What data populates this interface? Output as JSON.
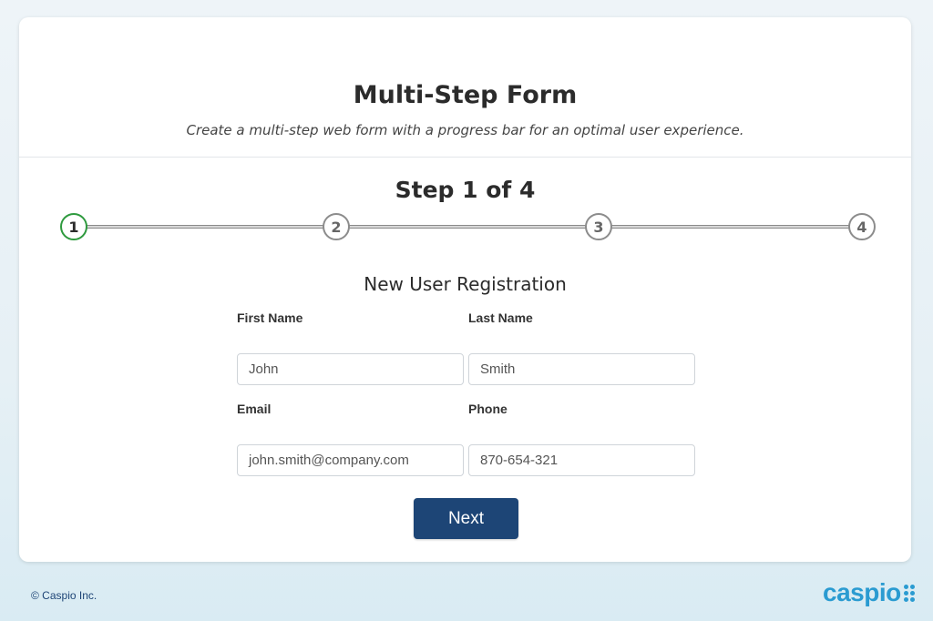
{
  "header": {
    "title": "Multi-Step Form",
    "subtitle": "Create a multi-step web form with a progress bar for an optimal user experience."
  },
  "progress": {
    "step_text": "Step 1 of 4",
    "current_step": 1,
    "total_steps": 4,
    "steps": [
      "1",
      "2",
      "3",
      "4"
    ],
    "active_color": "#2e9a3e",
    "inactive_color": "#8c8c8c"
  },
  "form": {
    "section_title": "New User Registration",
    "fields": {
      "first_name": {
        "label": "First Name",
        "value": "John"
      },
      "last_name": {
        "label": "Last Name",
        "value": "Smith"
      },
      "email": {
        "label": "Email",
        "value": "john.smith@company.com"
      },
      "phone": {
        "label": "Phone",
        "value": "870-654-321"
      }
    },
    "next_label": "Next",
    "button_color": "#1d4576"
  },
  "footer": {
    "copyright": "© Caspio Inc.",
    "logo_text": "caspio",
    "logo_color": "#2a9bd1"
  }
}
